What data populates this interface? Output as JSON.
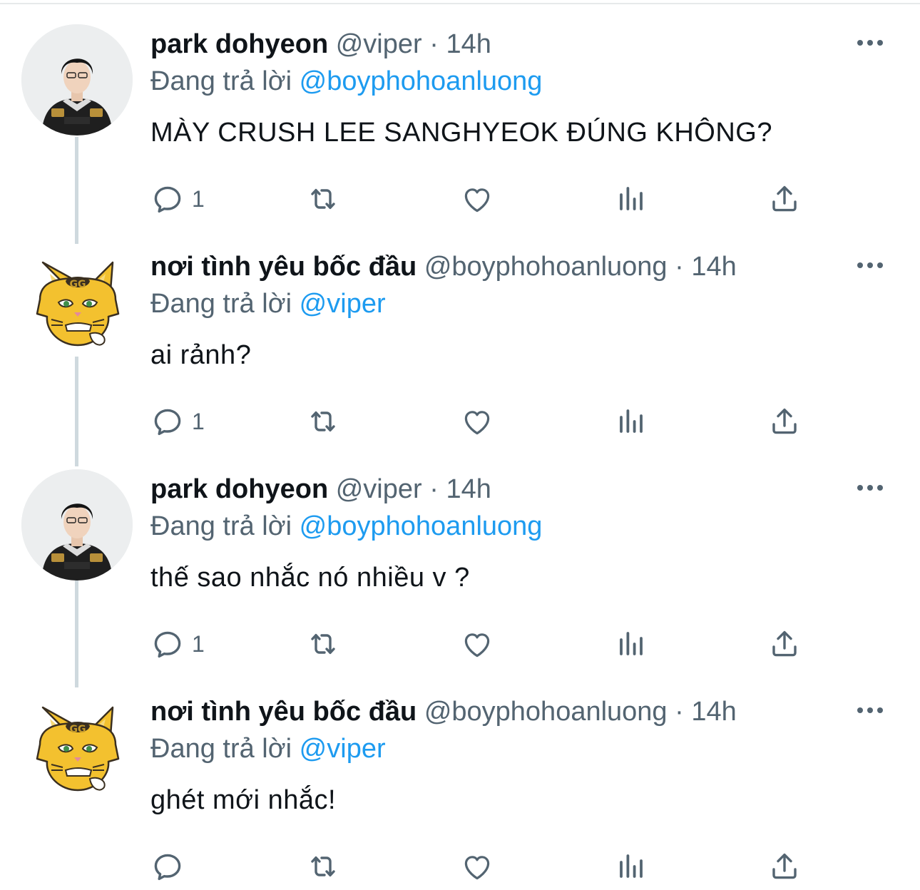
{
  "tweets": [
    {
      "name": "park dohyeon",
      "handle": "@viper",
      "dot": "·",
      "time": "14h",
      "reply_prefix": "Đang trả lời",
      "reply_to": "@boyphohoanluong",
      "text": "MÀY CRUSH LEE SANGHYEOK ĐÚNG KHÔNG?",
      "reply_count": "1",
      "avatar": "player-photo"
    },
    {
      "name": "nơi tình yêu bốc đầu",
      "handle": "@boyphohoanluong",
      "dot": "·",
      "time": "14h",
      "reply_prefix": "Đang trả lời",
      "reply_to": "@viper",
      "text": "ai rảnh?",
      "reply_count": "1",
      "avatar": "cartoon-cat"
    },
    {
      "name": "park dohyeon",
      "handle": "@viper",
      "dot": "·",
      "time": "14h",
      "reply_prefix": "Đang trả lời",
      "reply_to": "@boyphohoanluong",
      "text": "thế sao nhắc nó nhiều v ?",
      "reply_count": "1",
      "avatar": "player-photo"
    },
    {
      "name": "nơi tình yêu bốc đầu",
      "handle": "@boyphohoanluong",
      "dot": "·",
      "time": "14h",
      "reply_prefix": "Đang trả lời",
      "reply_to": "@viper",
      "text": "ghét mới nhắc!",
      "reply_count": "",
      "avatar": "cartoon-cat"
    }
  ],
  "colors": {
    "text": "#0f1419",
    "muted": "#536471",
    "link": "#1d9bf0",
    "thread_line": "#cfd9de"
  }
}
